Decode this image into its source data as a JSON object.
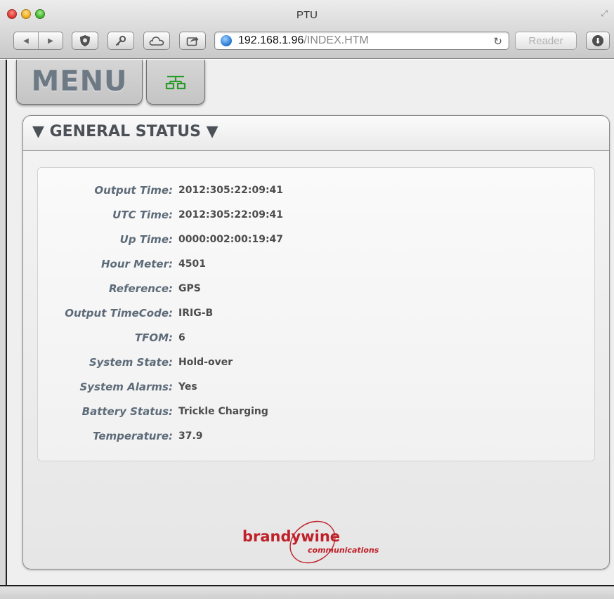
{
  "window": {
    "title": "PTU",
    "url_host": "192.168.1.96",
    "url_path": "/INDEX.HTM",
    "reader_label": "Reader"
  },
  "toolbar": {
    "icons": [
      "back-icon",
      "forward-icon",
      "shield-icon",
      "key-icon",
      "cloud-icon",
      "share-icon",
      "reload-icon",
      "download-icon"
    ]
  },
  "nav": {
    "menu_label": "MENU",
    "network_icon": "network-icon",
    "network_icon_color": "#2a9a2a"
  },
  "panel": {
    "title": "▼ GENERAL STATUS ▼"
  },
  "status": {
    "rows": [
      {
        "label": "Output Time:",
        "value": "2012:305:22:09:41"
      },
      {
        "label": "UTC Time:",
        "value": "2012:305:22:09:41"
      },
      {
        "label": "Up Time:",
        "value": "0000:002:00:19:47"
      },
      {
        "label": "Hour Meter:",
        "value": "4501"
      },
      {
        "label": "Reference:",
        "value": "GPS"
      },
      {
        "label": "Output TimeCode:",
        "value": "IRIG-B"
      },
      {
        "label": "TFOM:",
        "value": "6"
      },
      {
        "label": "System State:",
        "value": "Hold-over"
      },
      {
        "label": "System Alarms:",
        "value": "Yes"
      },
      {
        "label": "Battery Status:",
        "value": "Trickle Charging"
      },
      {
        "label": "Temperature:",
        "value": "37.9"
      }
    ]
  },
  "brand": {
    "name": "brandywine",
    "tagline": "communications",
    "color": "#c0202a"
  }
}
